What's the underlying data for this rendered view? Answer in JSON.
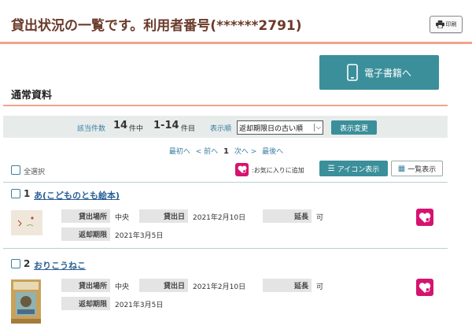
{
  "header": {
    "title": "貸出状況の一覧です。利用者番号(******2791)",
    "print_label": "印刷"
  },
  "ebook_button": {
    "label": "電子書籍へ"
  },
  "section": {
    "title": "通常資料"
  },
  "results": {
    "count_label": "該当件数",
    "count": "14",
    "count_unit": "件中",
    "range": "1-14",
    "range_unit": "件目",
    "sort_label": "表示順",
    "sort_value": "返却期限日の古い順",
    "apply_label": "表示変更"
  },
  "pager": {
    "first": "最初へ",
    "prev": "< 前へ",
    "current": "1",
    "next": "次へ >",
    "last": "最後へ"
  },
  "toolbar": {
    "select_all": "全選択",
    "fav_add": ":お気に入りに追加",
    "icon_view": "アイコン表示",
    "list_view": "一覧表示"
  },
  "labels": {
    "location": "貸出場所",
    "date": "貸出日",
    "extend": "延長",
    "due": "返却期限"
  },
  "items": [
    {
      "num": "1",
      "title": "あ(こどものとも絵本)",
      "location": "中央",
      "date": "2021年2月10日",
      "extend": "可",
      "due": "2021年3月5日"
    },
    {
      "num": "2",
      "title": "おりこうねこ",
      "location": "中央",
      "date": "2021年2月10日",
      "extend": "可",
      "due": "2021年3月5日"
    }
  ],
  "colors": {
    "accent": "#3a8f9a",
    "title_brown": "#6b3a2a",
    "divider": "#f2a48d",
    "fav_pink": "#d6136f",
    "link_blue": "#2b5f95"
  }
}
